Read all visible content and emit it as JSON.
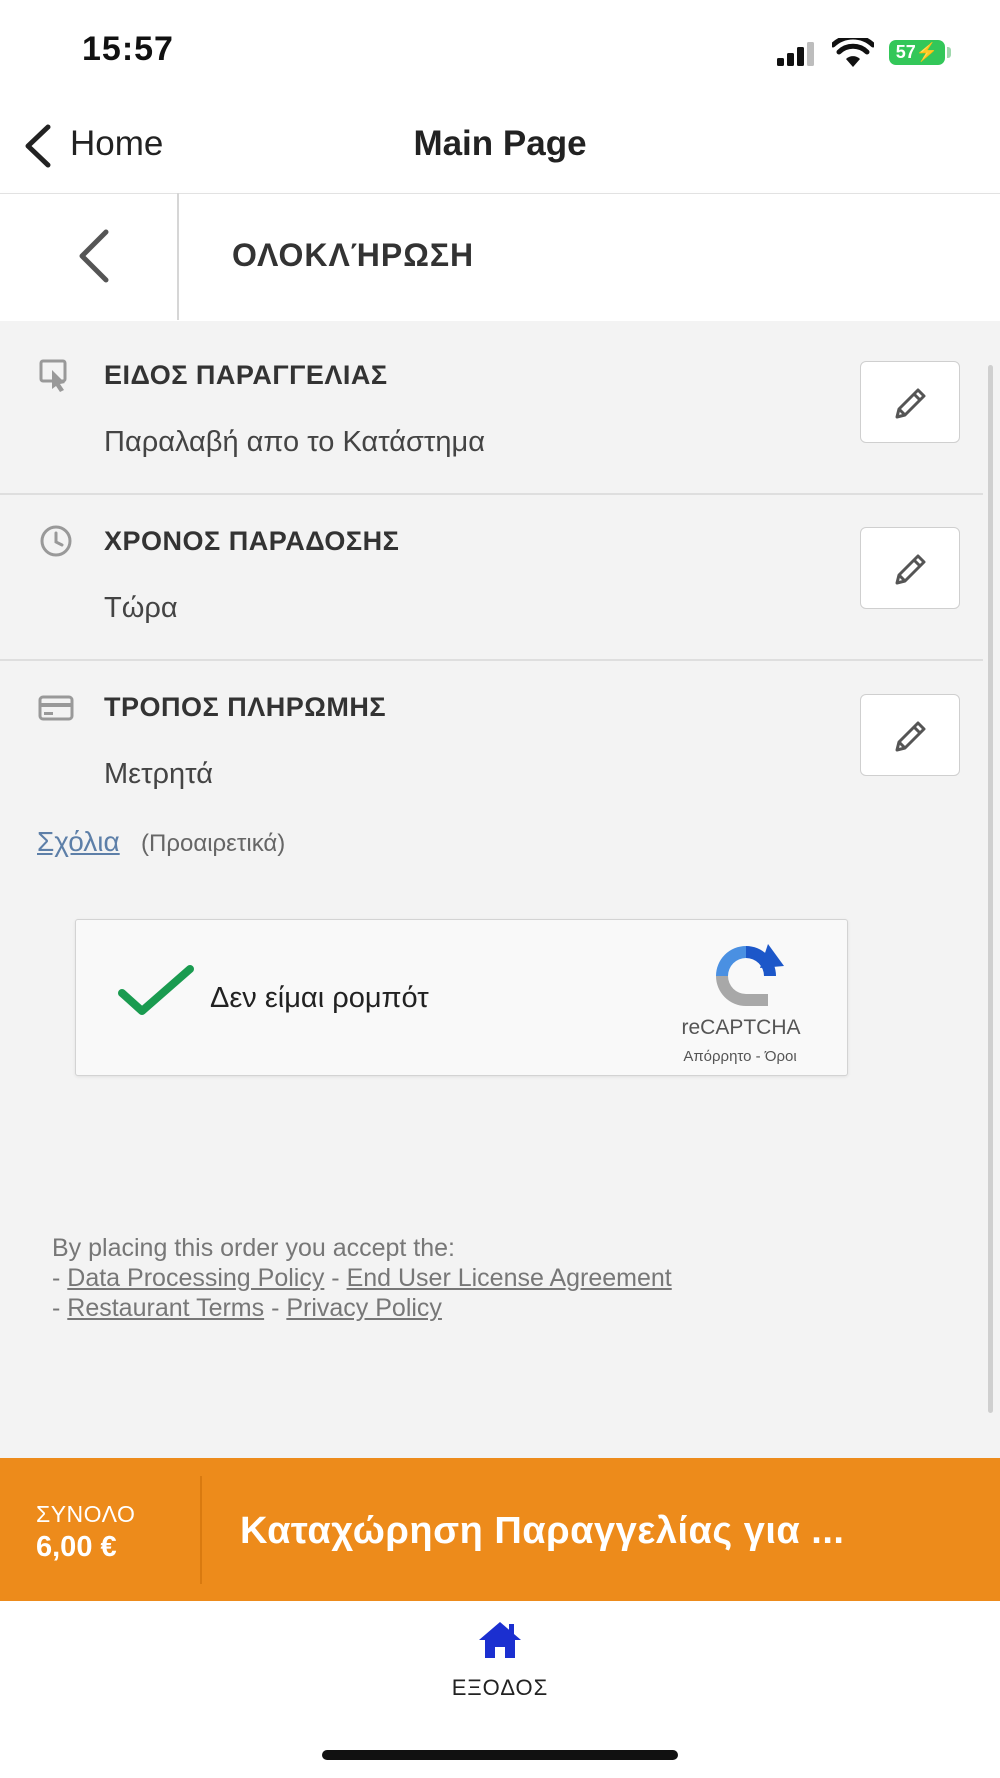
{
  "status_bar": {
    "time": "15:57",
    "battery": "57"
  },
  "nav": {
    "back_label": "Home",
    "title": "Main Page"
  },
  "page_header": {
    "title": "ΟΛΟΚΛΉΡΩΣΗ"
  },
  "sections": [
    {
      "title": "ΕΙΔΟΣ ΠΑΡΑΓΓΕΛΙΑΣ",
      "value": "Παραλαβή απο το Κατάστημα",
      "icon": "hand-pointer-icon"
    },
    {
      "title": "ΧΡΟΝΟΣ ΠΑΡΑΔΟΣΗΣ",
      "value": "Τώρα",
      "icon": "clock-icon"
    },
    {
      "title": "ΤΡΟΠΟΣ ΠΛΗΡΩΜΗΣ",
      "value": "Μετρητά",
      "icon": "credit-card-icon"
    }
  ],
  "comments": {
    "link": "Σχόλια",
    "optional": "(Προαιρετικά)"
  },
  "recaptcha": {
    "label": "Δεν είμαι ρομπότ",
    "brand": "reCAPTCHA",
    "privacy": "Απόρρητο",
    "separator": " - ",
    "terms": "Όροι",
    "checked": true
  },
  "legal": {
    "intro": "By placing this order you accept the:",
    "dash": "- ",
    "sep": " - ",
    "data_processing": "Data Processing Policy",
    "eula": "End User License Agreement",
    "restaurant_terms": "Restaurant Terms",
    "privacy": "Privacy Policy"
  },
  "order_bar": {
    "total_label": "ΣΥΝΟΛΟ",
    "total_value": "6,00 €",
    "submit_label": "Καταχώρηση Παραγγελίας για ..."
  },
  "tab_bar": {
    "label": "ΕΞΟΔΟΣ",
    "icon": "home-icon"
  },
  "colors": {
    "accent": "#ed8b1b",
    "check": "#1a9b50",
    "link": "#5d7fa8",
    "home_icon": "#1b2fd0",
    "battery": "#33c759"
  }
}
